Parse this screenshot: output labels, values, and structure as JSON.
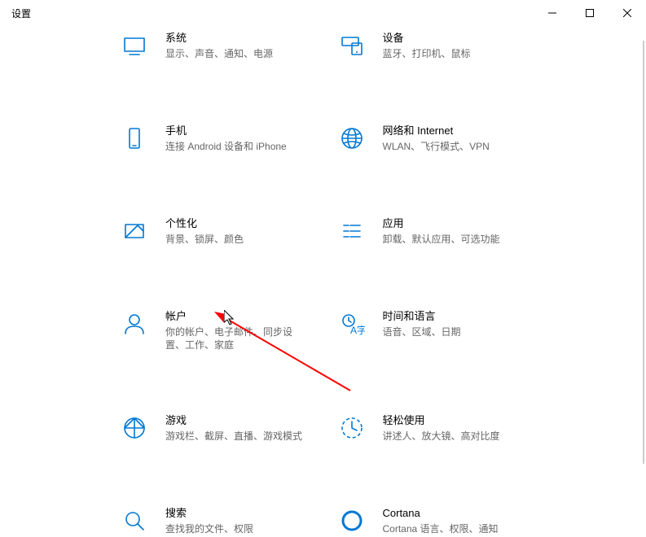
{
  "window": {
    "title": "设置"
  },
  "categories": [
    {
      "title": "系统",
      "sub": "显示、声音、通知、电源",
      "icon": "system"
    },
    {
      "title": "设备",
      "sub": "蓝牙、打印机、鼠标",
      "icon": "devices"
    },
    {
      "title": "手机",
      "sub": "连接 Android 设备和 iPhone",
      "icon": "phone"
    },
    {
      "title": "网络和 Internet",
      "sub": "WLAN、飞行模式、VPN",
      "icon": "network"
    },
    {
      "title": "个性化",
      "sub": "背景、锁屏、颜色",
      "icon": "personalization"
    },
    {
      "title": "应用",
      "sub": "卸载、默认应用、可选功能",
      "icon": "apps"
    },
    {
      "title": "帐户",
      "sub": "你的帐户、电子邮件、同步设置、工作、家庭",
      "icon": "accounts"
    },
    {
      "title": "时间和语言",
      "sub": "语音、区域、日期",
      "icon": "time-language"
    },
    {
      "title": "游戏",
      "sub": "游戏栏、截屏、直播、游戏模式",
      "icon": "gaming"
    },
    {
      "title": "轻松使用",
      "sub": "讲述人、放大镜、高对比度",
      "icon": "ease"
    },
    {
      "title": "搜索",
      "sub": "查找我的文件、权限",
      "icon": "search"
    },
    {
      "title": "Cortana",
      "sub": "Cortana 语言、权限、通知",
      "icon": "cortana"
    }
  ]
}
